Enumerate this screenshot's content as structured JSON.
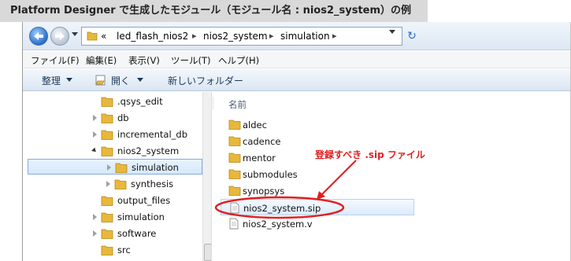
{
  "caption": "Platform Designer で生成したモジュール（モジュール名 : nios2_system）の例",
  "address": {
    "chevron": "«",
    "segments": [
      "led_flash_nios2",
      "nios2_system",
      "simulation"
    ],
    "separator": "▸"
  },
  "menu": [
    "ファイル(F)",
    "編集(E)",
    "表示(V)",
    "ツール(T)",
    "ヘルプ(H)"
  ],
  "commands": {
    "organize": "整理",
    "open": "開く",
    "new_folder": "新しいフォルダー"
  },
  "tree": [
    {
      "label": ".qsys_edit",
      "expander": "none"
    },
    {
      "label": "db",
      "expander": "closed"
    },
    {
      "label": "incremental_db",
      "expander": "closed"
    },
    {
      "label": "nios2_system",
      "expander": "open"
    },
    {
      "label": "simulation",
      "expander": "closed",
      "selected": true
    },
    {
      "label": "synthesis",
      "expander": "closed"
    },
    {
      "label": "output_files",
      "expander": "none"
    },
    {
      "label": "simulation",
      "expander": "closed"
    },
    {
      "label": "software",
      "expander": "closed"
    },
    {
      "label": "src",
      "expander": "none"
    }
  ],
  "content": {
    "column_header": "名前",
    "items": [
      {
        "name": "aldec",
        "type": "folder"
      },
      {
        "name": "cadence",
        "type": "folder"
      },
      {
        "name": "mentor",
        "type": "folder"
      },
      {
        "name": "submodules",
        "type": "folder"
      },
      {
        "name": "synopsys",
        "type": "folder"
      },
      {
        "name": "nios2_system.sip",
        "type": "file",
        "selected": true
      },
      {
        "name": "nios2_system.v",
        "type": "file"
      }
    ]
  },
  "annotation": {
    "text": "登録すべき .sip ファイル",
    "color": "#e02020"
  },
  "colors": {
    "folder": "#e8b83a",
    "selection_border": "#84acdd",
    "annotation": "#e02020"
  }
}
